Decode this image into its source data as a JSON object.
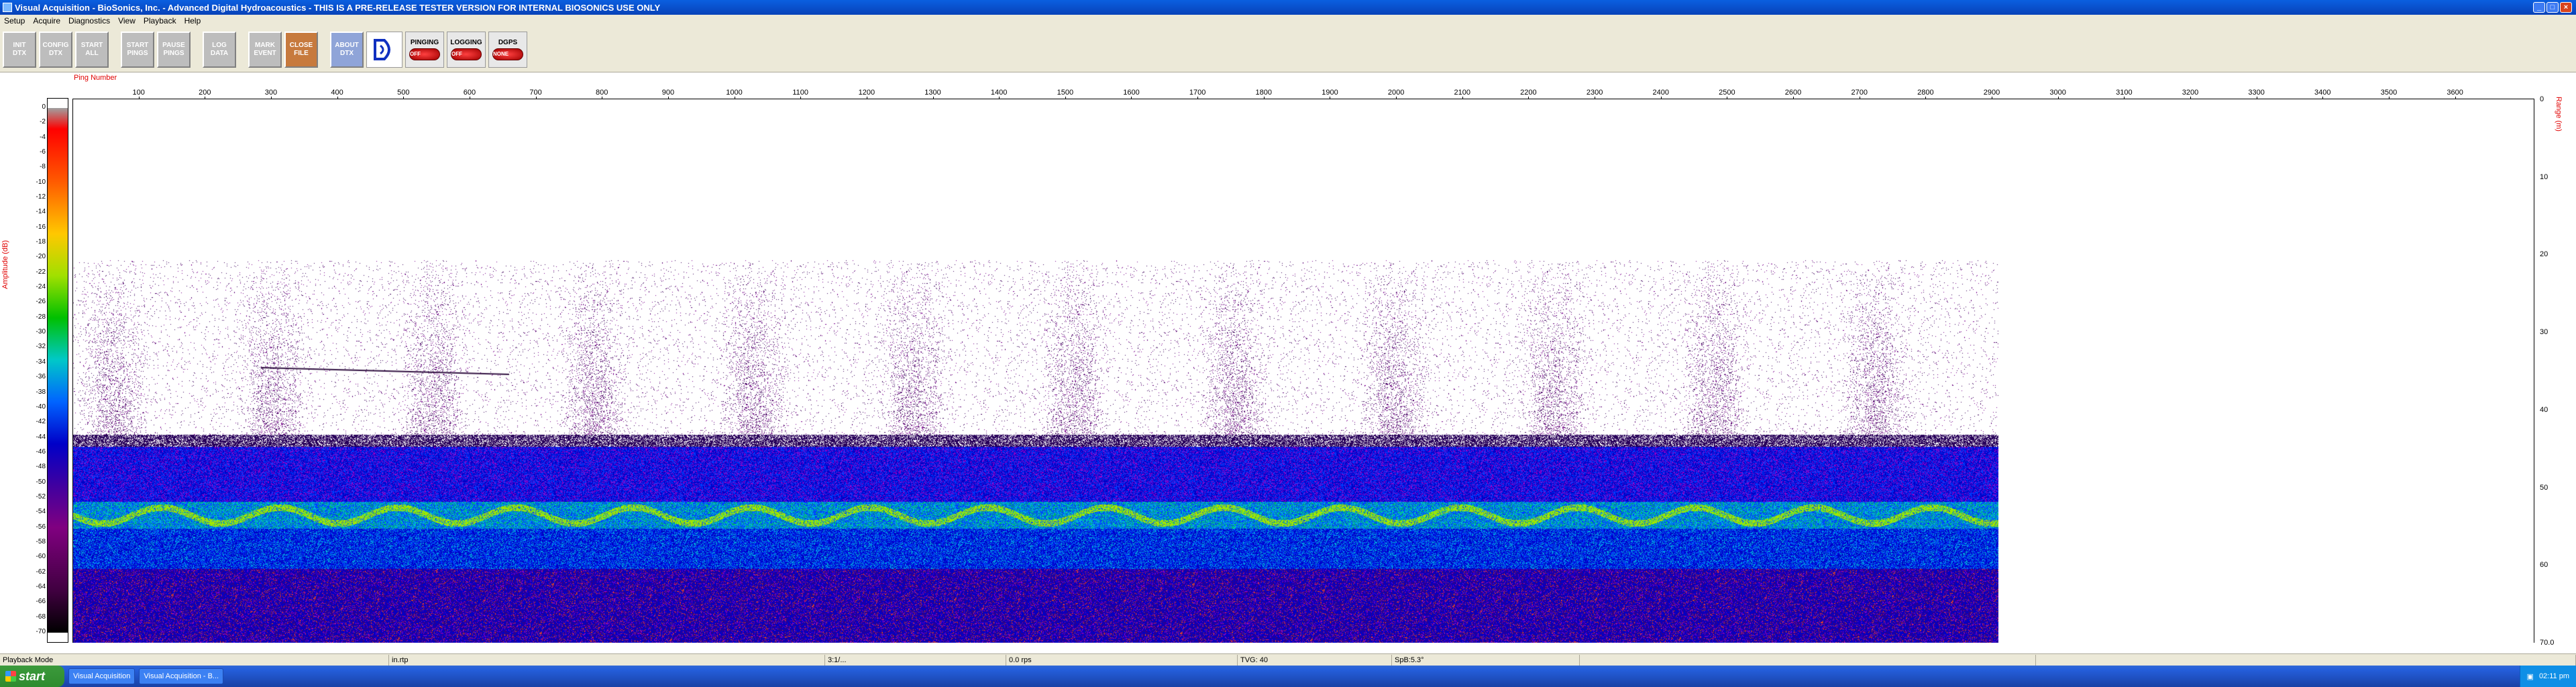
{
  "window": {
    "title": "Visual Acquisition  -  BioSonics, Inc.  -  Advanced Digital Hydroacoustics  -  THIS IS A PRE-RELEASE TESTER VERSION FOR INTERNAL BIOSONICS USE ONLY"
  },
  "menu": [
    "Setup",
    "Acquire",
    "Diagnostics",
    "View",
    "Playback",
    "Help"
  ],
  "toolbar": {
    "buttons": [
      {
        "line1": "INIT",
        "line2": "DTX"
      },
      {
        "line1": "CONFIG",
        "line2": "DTX"
      },
      {
        "line1": "START",
        "line2": "ALL"
      },
      {
        "line1": "START",
        "line2": "PINGS"
      },
      {
        "line1": "PAUSE",
        "line2": "PINGS"
      },
      {
        "line1": "LOG",
        "line2": "DATA"
      },
      {
        "line1": "MARK",
        "line2": "EVENT"
      },
      {
        "line1": "CLOSE",
        "line2": "FILE"
      },
      {
        "line1": "ABOUT",
        "line2": "DTX"
      }
    ],
    "status": [
      {
        "label": "PINGING",
        "state": "OFF"
      },
      {
        "label": "LOGGING",
        "state": "OFF"
      },
      {
        "label": "DGPS",
        "state": "NONE"
      }
    ]
  },
  "echogram": {
    "x_label": "Ping Number",
    "y_label": "Amplitude (dB)",
    "range_label": "Range (m)",
    "x_ticks": [
      "100",
      "200",
      "300",
      "400",
      "500",
      "600",
      "700",
      "800",
      "900",
      "1000",
      "1100",
      "1200",
      "1300",
      "1400",
      "1500",
      "1600",
      "1700",
      "1800",
      "1900",
      "2000",
      "2100",
      "2200",
      "2300",
      "2400",
      "2500",
      "2600",
      "2700",
      "2800",
      "2900",
      "3000",
      "3100",
      "3200",
      "3300",
      "3400",
      "3500",
      "3600"
    ],
    "amp_ticks": [
      "0",
      "-2",
      "-4",
      "-6",
      "-8",
      "-10",
      "-12",
      "-14",
      "-16",
      "-18",
      "-20",
      "-22",
      "-24",
      "-26",
      "-28",
      "-30",
      "-32",
      "-34",
      "-36",
      "-38",
      "-40",
      "-42",
      "-44",
      "-46",
      "-48",
      "-50",
      "-52",
      "-54",
      "-56",
      "-58",
      "-60",
      "-62",
      "-64",
      "-66",
      "-68",
      "-70"
    ],
    "range_ticks": [
      "0",
      "10",
      "20",
      "30",
      "40",
      "50",
      "60",
      "70.0"
    ],
    "pings_shown": 2870
  },
  "statusbar": {
    "mode": "Playback Mode",
    "file": "in.rtp",
    "counter": "3:1/...",
    "rate": "0.0 rps",
    "tvg": "TVG: 40",
    "spb": "SpB:5.3°"
  },
  "taskbar": {
    "start": "start",
    "items": [
      "Visual Acquisition",
      "Visual Acquisition - B..."
    ],
    "clock": "02:11 pm"
  }
}
